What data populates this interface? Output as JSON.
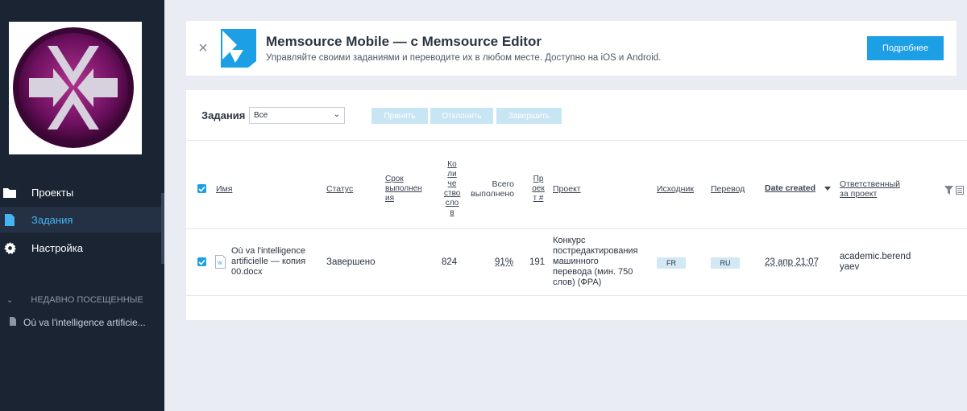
{
  "sidebar": {
    "nav": [
      {
        "label": "Проекты",
        "icon": "folder-icon"
      },
      {
        "label": "Задания",
        "icon": "file-icon"
      },
      {
        "label": "Настройка",
        "icon": "gear-icon"
      }
    ],
    "recent_heading": "НЕДАВНО ПОСЕЩЕННЫЕ",
    "recent_items": [
      {
        "label": "Où va l'intelligence artificie...",
        "icon": "document-icon"
      }
    ]
  },
  "banner": {
    "title": "Memsource Mobile — с Memsource Editor",
    "subtitle": "Управляйте своими заданиями и переводите их в любом месте. Доступно на iOS и Android.",
    "button": "Подробнее",
    "close_icon": "close-icon"
  },
  "toolbar": {
    "label": "Задания",
    "filter_value": "Все",
    "accept": "Принять",
    "decline": "Отклонить",
    "complete": "Завершить"
  },
  "table": {
    "headers": {
      "name": "Имя",
      "status": "Статус",
      "due": [
        "Срок",
        "выполнен",
        "ия"
      ],
      "count": [
        "Ко",
        "ли",
        "че",
        "ство",
        "сло",
        "в"
      ],
      "total": [
        "Всего",
        "выполнено"
      ],
      "project_no": [
        "Пр",
        "оек",
        "т #"
      ],
      "project": "Проект",
      "source": "Исходник",
      "target": "Перевод",
      "date_created": "Date created",
      "owner": [
        "Ответственный",
        "за проект"
      ]
    },
    "rows": [
      {
        "name": [
          "Où va l'intelligence",
          "artificielle — копия",
          "00.docx"
        ],
        "status": "Завершено",
        "count": "824",
        "total": "91%",
        "project_no": "191",
        "project": [
          "Конкурс",
          "постредактирования",
          "машинного",
          "перевода (мин. 750",
          "слов) (ФРА)"
        ],
        "source": "FR",
        "target": "RU",
        "date_created": "23 апр 21:07",
        "owner": [
          "academic.berend",
          "yaev"
        ]
      }
    ]
  },
  "colors": {
    "accent": "#1d9fe5",
    "sidebar_bg": "#1b2433",
    "active_text": "#45b4f1"
  }
}
